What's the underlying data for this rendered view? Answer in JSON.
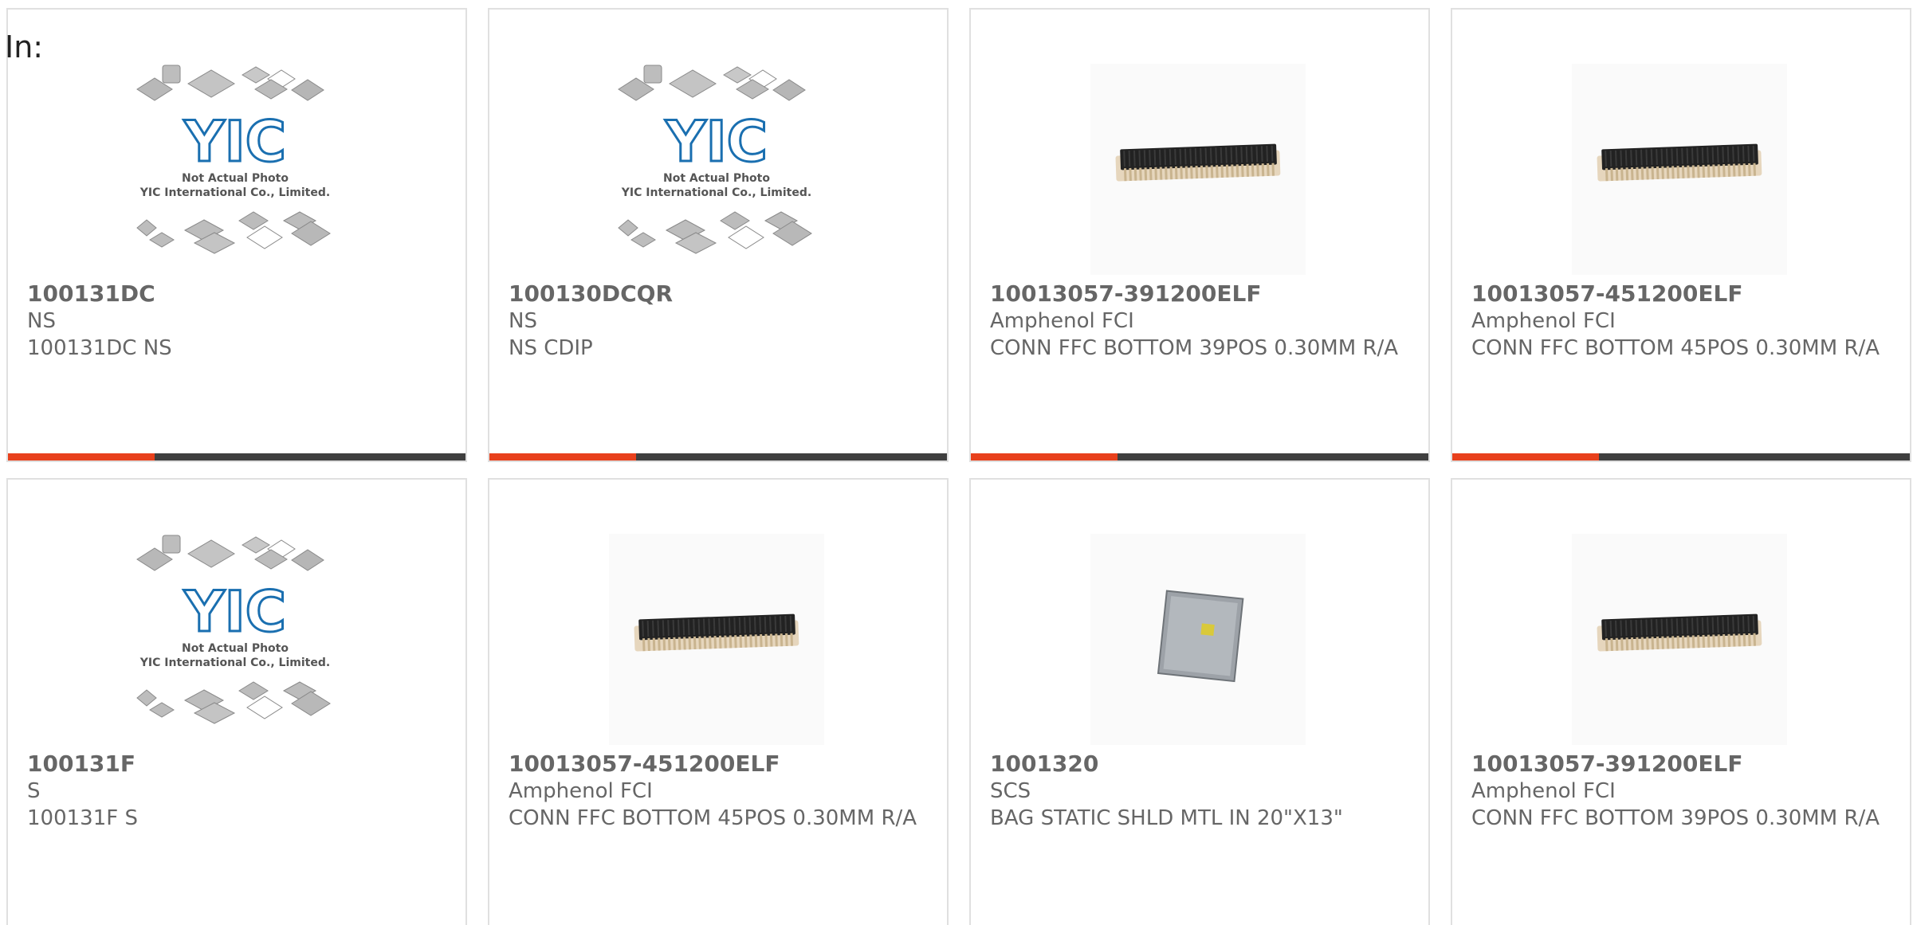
{
  "filter_label": "In:",
  "colors": {
    "accent": "#e8401c",
    "bar_track": "#3f3f3f",
    "text": "#666666",
    "yic_blue": "#1a6fb0"
  },
  "placeholder_image": {
    "line1": "Not Actual Photo",
    "line2": "YIC International Co., Limited.",
    "logo": "YIC"
  },
  "products": [
    {
      "part": "100131DC",
      "maker": "NS",
      "desc": "100131DC NS",
      "image": "yic-placeholder",
      "progress": 0.32
    },
    {
      "part": "100130DCQR",
      "maker": "NS",
      "desc": "NS CDIP",
      "image": "yic-placeholder",
      "progress": 0.32
    },
    {
      "part": "10013057-391200ELF",
      "maker": "Amphenol FCI",
      "desc": "CONN FFC BOTTOM 39POS 0.30MM R/A",
      "image": "ffc-connector",
      "progress": 0.32
    },
    {
      "part": "10013057-451200ELF",
      "maker": "Amphenol FCI",
      "desc": "CONN FFC BOTTOM 45POS 0.30MM R/A",
      "image": "ffc-connector",
      "progress": 0.32
    },
    {
      "part": "100131F",
      "maker": "S",
      "desc": "100131F S",
      "image": "yic-placeholder",
      "progress": 0.32
    },
    {
      "part": "10013057-451200ELF",
      "maker": "Amphenol FCI",
      "desc": "CONN FFC BOTTOM 45POS 0.30MM R/A",
      "image": "ffc-connector",
      "progress": 0.32
    },
    {
      "part": "1001320",
      "maker": "SCS",
      "desc": "BAG STATIC SHLD MTL IN 20\"X13\"",
      "image": "static-bag",
      "progress": 0.32
    },
    {
      "part": "10013057-391200ELF",
      "maker": "Amphenol FCI",
      "desc": "CONN FFC BOTTOM 39POS 0.30MM R/A",
      "image": "ffc-connector",
      "progress": 0.32
    }
  ]
}
